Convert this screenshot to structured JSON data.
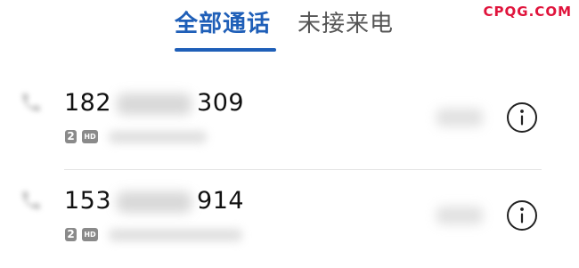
{
  "tabs": {
    "all_calls": "全部通话",
    "missed_calls": "未接来电"
  },
  "watermark": "CPQG.COM",
  "calls": [
    {
      "number_prefix": "182",
      "number_suffix": "309",
      "sim_label": "2",
      "hd_label": "HD"
    },
    {
      "number_prefix": "153",
      "number_suffix": "914",
      "sim_label": "2",
      "hd_label": "HD"
    }
  ],
  "icons": {
    "call_type": "phone-icon",
    "details": "info-icon"
  },
  "colors": {
    "accent": "#1f5fb8",
    "watermark": "#e0143c",
    "badge": "#8a8a8a"
  }
}
